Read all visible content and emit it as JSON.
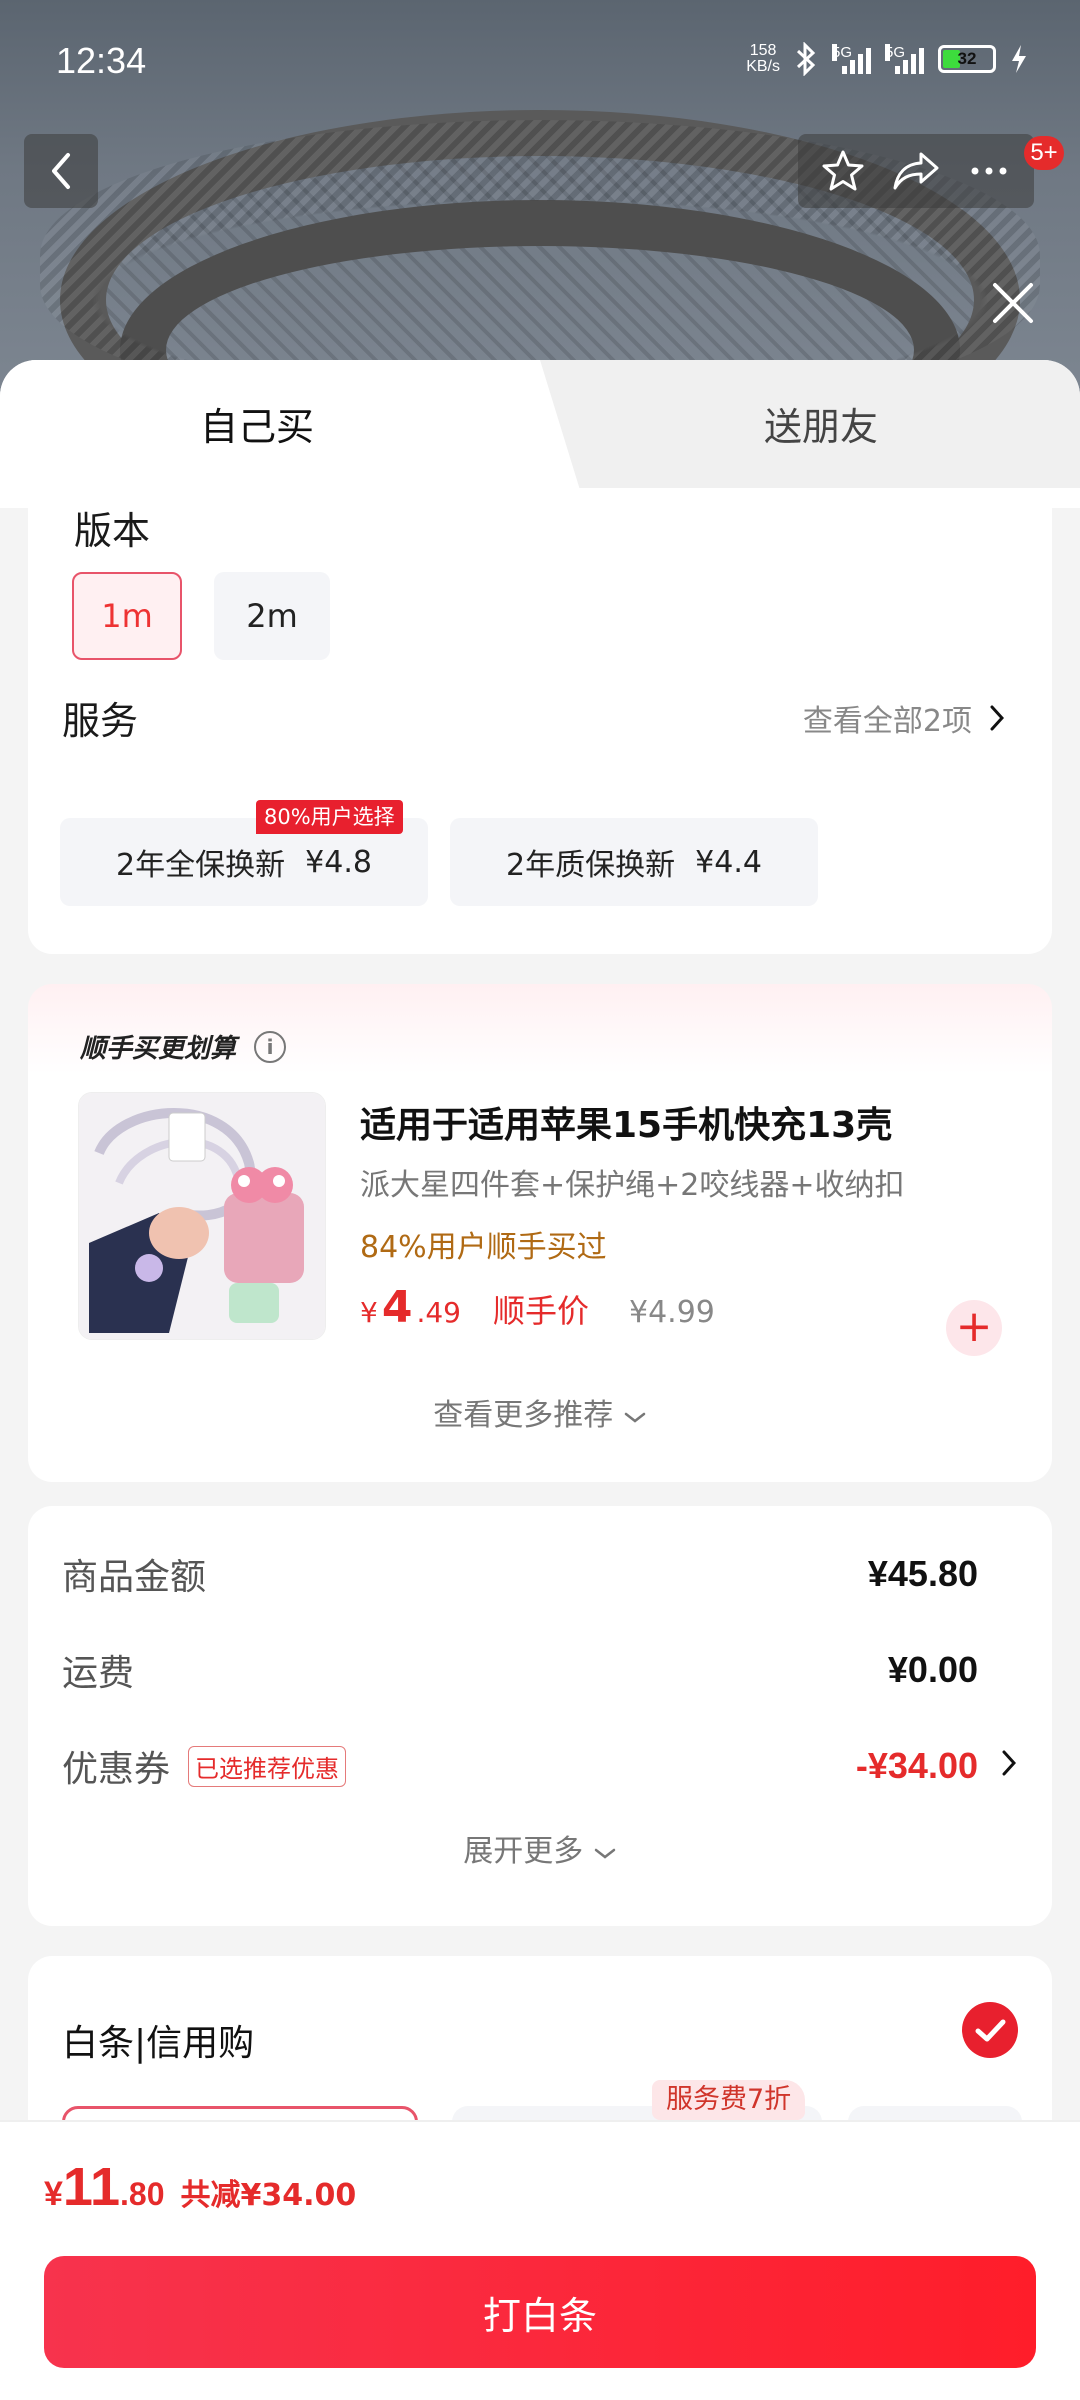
{
  "status_bar": {
    "time": "12:34",
    "net_speed_value": "158",
    "net_speed_unit": "KB/s",
    "signal1_label": "5G",
    "signal2_label": "5G",
    "battery": "32"
  },
  "header": {
    "badge": "5+",
    "icons": [
      "back-icon",
      "star-icon",
      "share-icon",
      "more-icon",
      "close-icon"
    ]
  },
  "tabs": [
    {
      "label": "自己买",
      "active": true
    },
    {
      "label": "送朋友",
      "active": false
    }
  ],
  "version": {
    "title": "版本",
    "options": [
      {
        "label": "1m",
        "selected": true
      },
      {
        "label": "2m",
        "selected": false
      }
    ]
  },
  "service": {
    "title": "服务",
    "see_all": "查看全部2项",
    "hot_badge": "80%用户选择",
    "options": [
      {
        "name": "2年全保换新",
        "price": "¥4.8"
      },
      {
        "name": "2年质保换新",
        "price": "¥4.4"
      }
    ]
  },
  "addon": {
    "section_title": "顺手买更划算",
    "product_title": "适用于适用苹果15手机快充13壳",
    "product_subtitle": "派大星四件套+保护绳+2咬线器+收纳扣",
    "hint": "84%用户顺手买过",
    "price_currency": "¥",
    "price_int": "4",
    "price_dec": ".49",
    "price_label": "顺手价",
    "original_price": "¥4.99",
    "more": "查看更多推荐"
  },
  "summary": {
    "rows": [
      {
        "label": "商品金额",
        "value": "¥45.80"
      },
      {
        "label": "运费",
        "value": "¥0.00"
      },
      {
        "label": "优惠券",
        "tag": "已选推荐优惠",
        "value": "-¥34.00"
      }
    ],
    "expand": "展开更多"
  },
  "payment": {
    "title": "白条|信用购",
    "fee_badge": "服务费7折",
    "checked": true
  },
  "bottom": {
    "currency": "¥",
    "total_int": "11",
    "total_dec": ".80",
    "saved": "共减¥34.00",
    "pay_button": "打白条"
  },
  "colors": {
    "accent": "#e52b2b",
    "hint": "#b06a14",
    "pay_button": "#ff1d2a"
  }
}
